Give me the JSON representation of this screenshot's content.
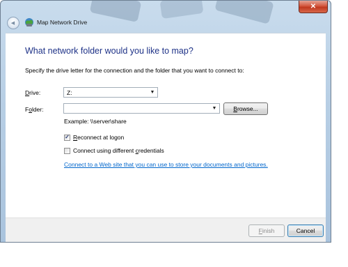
{
  "window": {
    "title": "Map Network Drive",
    "close_glyph": "✕",
    "back_glyph": "◀"
  },
  "content": {
    "heading": "What network folder would you like to map?",
    "instruction": "Specify the drive letter for the connection and the folder that you want to connect to:",
    "drive": {
      "label_pre": "",
      "label_key": "D",
      "label_post": "rive:",
      "value": "Z:"
    },
    "folder": {
      "label_pre": "F",
      "label_key": "o",
      "label_post": "lder:",
      "value": ""
    },
    "browse_button": {
      "key": "B",
      "rest": "rowse..."
    },
    "example": "Example: \\\\server\\share",
    "reconnect": {
      "key": "R",
      "rest": "econnect at logon",
      "checked": true,
      "check_glyph": "✓"
    },
    "different_credentials": {
      "pre": "Connect using different ",
      "key": "c",
      "rest": "redentials",
      "checked": false
    },
    "link": "Connect to a Web site that you can use to store your documents and pictures."
  },
  "footer": {
    "finish": {
      "key": "F",
      "rest": "inish",
      "enabled": false
    },
    "cancel": "Cancel"
  },
  "colors": {
    "heading": "#1e3287",
    "link": "#0066cc",
    "close_button": "#c0391f"
  }
}
